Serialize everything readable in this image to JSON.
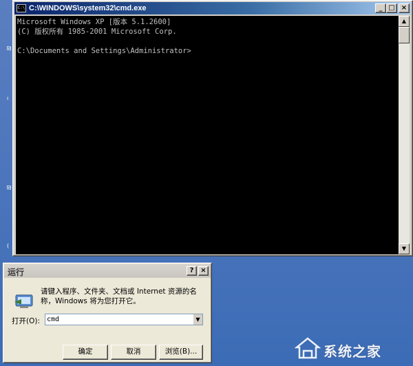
{
  "cmd_window": {
    "title": "C:\\WINDOWS\\system32\\cmd.exe",
    "app_icon_text": "C:\\",
    "minimize_glyph": "_",
    "maximize_glyph": "□",
    "close_glyph": "×",
    "console_lines": [
      "Microsoft Windows XP [版本 5.1.2600]",
      "(C) 版权所有 1985-2001 Microsoft Corp.",
      "",
      "C:\\Documents and Settings\\Administrator>"
    ]
  },
  "run_dialog": {
    "title": "运行",
    "help_glyph": "?",
    "close_glyph": "×",
    "description": "请键入程序、文件夹、文档或 Internet 资源的名称，Windows 将为您打开它。",
    "open_label": "打开(O):",
    "open_value": "cmd",
    "ok_label": "确定",
    "cancel_label": "取消",
    "browse_label": "浏览(B)..."
  },
  "watermark": {
    "text": "系统之家"
  },
  "colors": {
    "titlebar_active": "#0a246a",
    "console_bg": "#000000",
    "console_fg": "#c0c0c0",
    "dialog_bg": "#ece9d8",
    "desktop": "#4a74bb"
  }
}
